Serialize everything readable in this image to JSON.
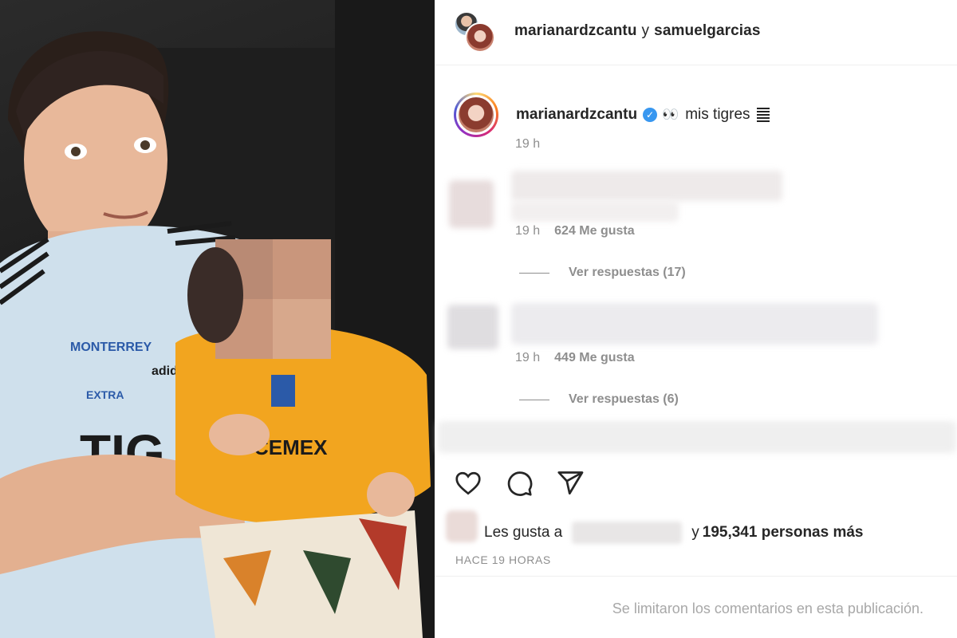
{
  "header": {
    "user1": "marianardzcantu",
    "connector": "y",
    "user2": "samuelgarcias"
  },
  "caption": {
    "username": "marianardzcantu",
    "verified_icon": "verified-badge-icon",
    "emoji": "👀",
    "text": "mis tigres",
    "flag_icon": "striped-flag-icon",
    "time": "19 h"
  },
  "comments": [
    {
      "time": "19 h",
      "likes": "624 Me gusta",
      "replies": "Ver respuestas (17)"
    },
    {
      "time": "19 h",
      "likes": "449 Me gusta",
      "replies": "Ver respuestas (6)"
    }
  ],
  "actions": {
    "like_icon": "heart-icon",
    "comment_icon": "comment-bubble-icon",
    "share_icon": "paper-plane-icon"
  },
  "likes": {
    "prefix": "Les gusta a",
    "connector": "y",
    "count": "195,341 personas más"
  },
  "post_age": "HACE 19 HORAS",
  "limit_notice": "Se limitaron los comentarios en esta publicación.",
  "colors": {
    "verified": "#3897f0",
    "secondary_text": "#8e8e8e",
    "primary_text": "#262626",
    "jersey_yellow": "#f2a51f",
    "jersey_lightblue": "#cfe0ec"
  }
}
